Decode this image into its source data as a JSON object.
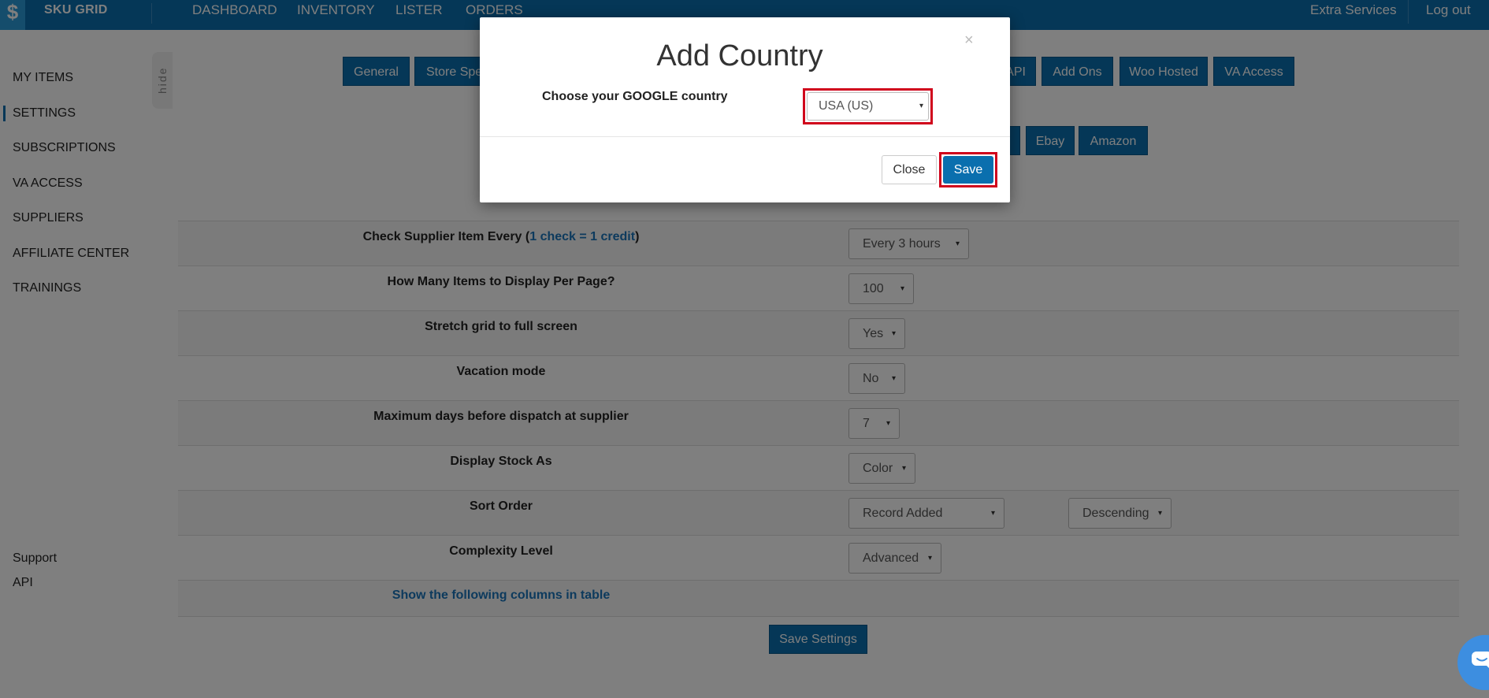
{
  "header": {
    "brand": "SKU GRID",
    "nav": [
      "DASHBOARD",
      "INVENTORY",
      "LISTER",
      "ORDERS"
    ],
    "extra_services": "Extra Services",
    "logout": "Log out"
  },
  "sidebar": {
    "items": [
      "MY ITEMS",
      "SETTINGS",
      "SUBSCRIPTIONS",
      "VA ACCESS",
      "SUPPLIERS",
      "AFFILIATE CENTER",
      "TRAININGS"
    ],
    "active": "SETTINGS",
    "hide_label": "hide",
    "bottom": [
      "Support",
      "API"
    ]
  },
  "tabs_row1": {
    "general": "General",
    "store_spe": "Store Spe",
    "api": "API",
    "add_ons": "Add Ons",
    "woo_hosted": "Woo Hosted",
    "va_access": "VA Access"
  },
  "tabs_row2": {
    "ebay": "Ebay",
    "amazon": "Amazon"
  },
  "settings": {
    "check_supplier": {
      "label_prefix": "Check Supplier Item Every (",
      "label_link": "1 check = 1 credit",
      "label_suffix": ")",
      "value": "Every 3 hours"
    },
    "items_per_page": {
      "label": "How Many Items to Display Per Page?",
      "value": "100"
    },
    "stretch_grid": {
      "label": "Stretch grid to full screen",
      "value": "Yes"
    },
    "vacation_mode": {
      "label": "Vacation mode",
      "value": "No"
    },
    "max_days": {
      "label": "Maximum days before dispatch at supplier",
      "value": "7"
    },
    "display_stock": {
      "label": "Display Stock As",
      "value": "Color"
    },
    "sort_order": {
      "label": "Sort Order",
      "value": "Record Added",
      "direction": "Descending"
    },
    "complexity": {
      "label": "Complexity Level",
      "value": "Advanced"
    },
    "columns_link": "Show the following columns in table",
    "save_button": "Save Settings"
  },
  "modal": {
    "title": "Add Country",
    "close_x": "×",
    "label": "Choose your GOOGLE country",
    "country_value": "USA (US)",
    "close_button": "Close",
    "save_button": "Save"
  },
  "icons": {
    "caret": "▾",
    "chat": "chat-icon"
  },
  "colors": {
    "primary": "#0a6fae",
    "highlight": "#d0021b",
    "link": "#1a75bb",
    "chat": "#3d8ee0"
  }
}
